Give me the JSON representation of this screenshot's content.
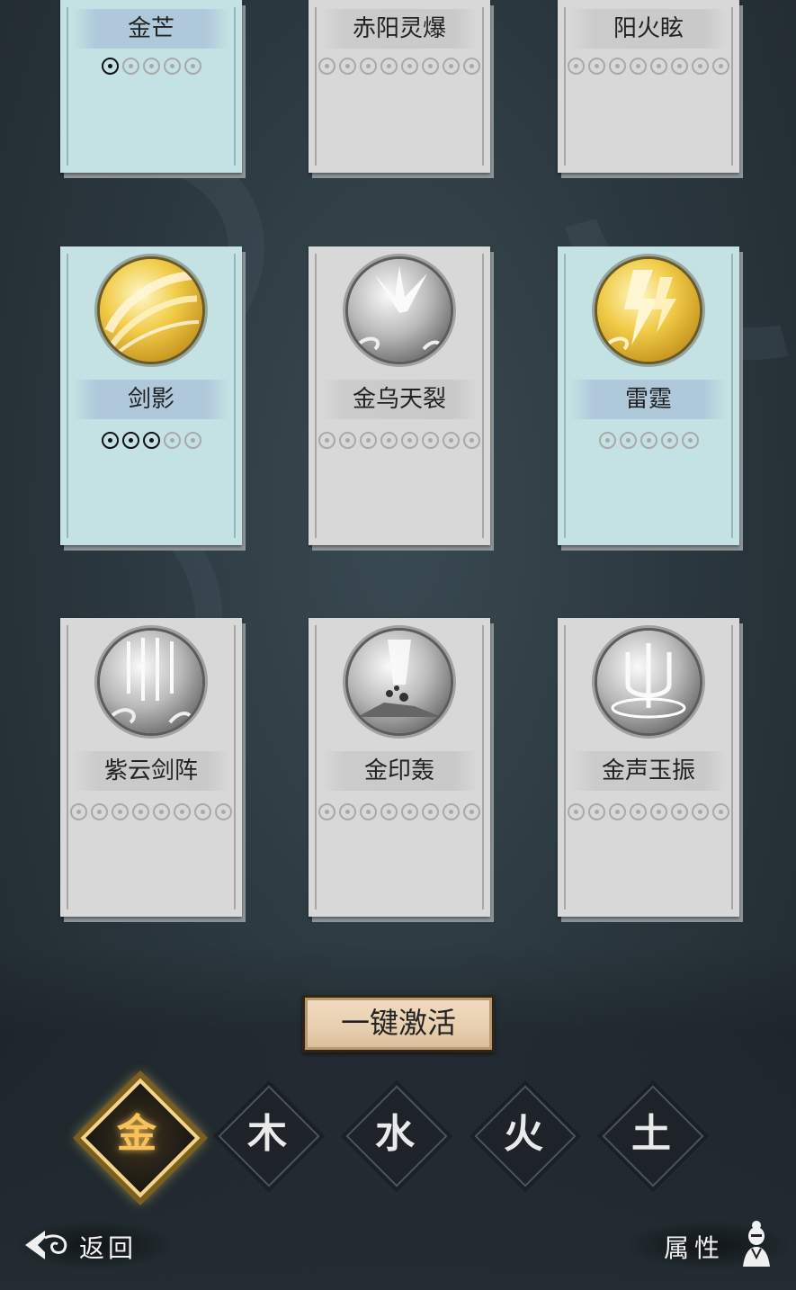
{
  "cards": [
    {
      "name": "金芒",
      "active": true,
      "level": 1,
      "max": 5,
      "top": true
    },
    {
      "name": "赤阳灵爆",
      "active": false,
      "level": 0,
      "max": 8,
      "top": true
    },
    {
      "name": "阳火眩",
      "active": false,
      "level": 0,
      "max": 8,
      "top": true
    },
    {
      "name": "剑影",
      "active": true,
      "level": 3,
      "max": 5,
      "icon": "sword-strike-icon"
    },
    {
      "name": "金乌天裂",
      "active": false,
      "level": 0,
      "max": 8,
      "icon": "burst-icon"
    },
    {
      "name": "雷霆",
      "active": true,
      "level": 0,
      "max": 5,
      "icon": "lightning-icon"
    },
    {
      "name": "紫云剑阵",
      "active": false,
      "level": 0,
      "max": 8,
      "icon": "sword-rain-icon"
    },
    {
      "name": "金印轰",
      "active": false,
      "level": 0,
      "max": 8,
      "icon": "impact-icon"
    },
    {
      "name": "金声玉振",
      "active": false,
      "level": 0,
      "max": 8,
      "icon": "trident-icon"
    }
  ],
  "activate_label": "一键激活",
  "elements": [
    {
      "label": "金",
      "selected": true
    },
    {
      "label": "木",
      "selected": false
    },
    {
      "label": "水",
      "selected": false
    },
    {
      "label": "火",
      "selected": false
    },
    {
      "label": "土",
      "selected": false
    }
  ],
  "back_label": "返回",
  "attr_label": "属性",
  "colors": {
    "card_active": "#c4e2e3",
    "card_inactive": "#d8d8d8",
    "gold": "#f7c15c",
    "button": "#e7ceaf"
  }
}
